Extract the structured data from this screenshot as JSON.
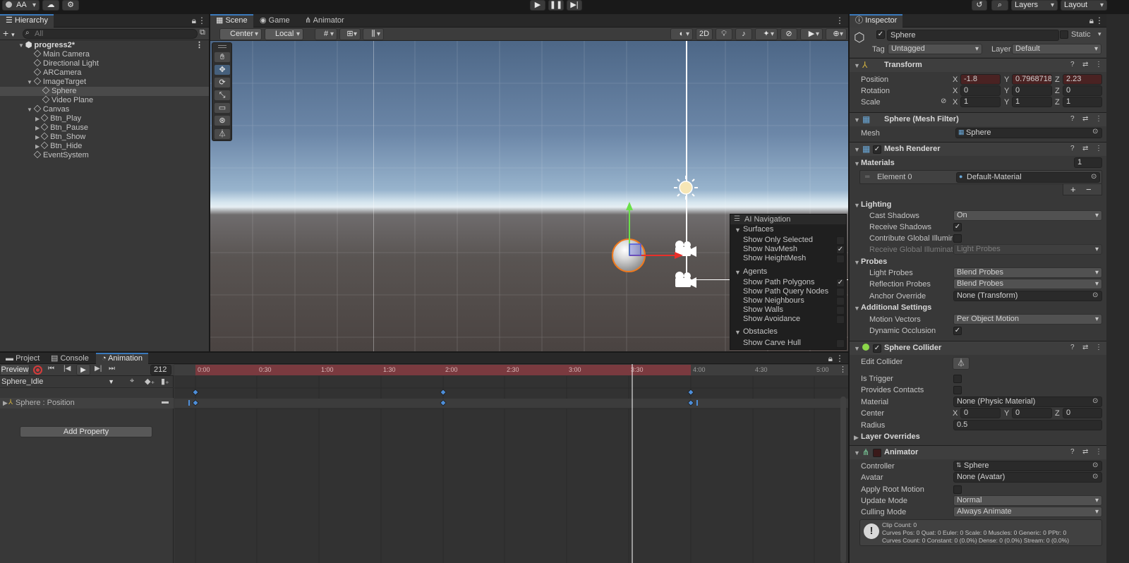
{
  "topbar": {
    "account_label": "AA",
    "layers_label": "Layers",
    "layout_label": "Layout"
  },
  "hierarchy": {
    "tab_label": "Hierarchy",
    "search_placeholder": "All",
    "items": [
      {
        "label": "progress2*"
      },
      {
        "label": "Main Camera"
      },
      {
        "label": "Directional Light"
      },
      {
        "label": "ARCamera"
      },
      {
        "label": "ImageTarget"
      },
      {
        "label": "Sphere"
      },
      {
        "label": "Video Plane"
      },
      {
        "label": "Canvas"
      },
      {
        "label": "Btn_Play"
      },
      {
        "label": "Btn_Pause"
      },
      {
        "label": "Btn_Show"
      },
      {
        "label": "Btn_Hide"
      },
      {
        "label": "EventSystem"
      }
    ]
  },
  "scene": {
    "tabs": [
      {
        "label": "Scene"
      },
      {
        "label": "Game"
      },
      {
        "label": "Animator"
      }
    ],
    "pivot_label": "Center",
    "space_label": "Local",
    "mode_2d_label": "2D",
    "ai_nav": {
      "title": "AI Navigation",
      "surfaces_label": "Surfaces",
      "surfaces": [
        {
          "label": "Show Only Selected",
          "checked": false
        },
        {
          "label": "Show NavMesh",
          "checked": true
        },
        {
          "label": "Show HeightMesh",
          "checked": false
        }
      ],
      "agents_label": "Agents",
      "agents": [
        {
          "label": "Show Path Polygons",
          "checked": true
        },
        {
          "label": "Show Path Query Nodes",
          "checked": false
        },
        {
          "label": "Show Neighbours",
          "checked": false
        },
        {
          "label": "Show Walls",
          "checked": false
        },
        {
          "label": "Show Avoidance",
          "checked": false
        }
      ],
      "obstacles_label": "Obstacles",
      "obstacles": [
        {
          "label": "Show Carve Hull",
          "checked": false
        }
      ]
    }
  },
  "bottom": {
    "tabs": [
      {
        "label": "Project"
      },
      {
        "label": "Console"
      },
      {
        "label": "Animation"
      }
    ],
    "preview_label": "Preview",
    "frame_value": "212",
    "clip_name": "Sphere_Idle",
    "property_label": "Sphere : Position",
    "add_property_label": "Add Property",
    "timeline_ticks": [
      "0:00",
      "0:30",
      "1:00",
      "1:30",
      "2:00",
      "2:30",
      "3:00",
      "3:30",
      "4:00",
      "4:30",
      "5:00"
    ]
  },
  "inspector": {
    "tab_label": "Inspector",
    "object_name": "Sphere",
    "static_label": "Static",
    "tag_label": "Tag",
    "tag_value": "Untagged",
    "layer_label": "Layer",
    "layer_value": "Default",
    "transform": {
      "title": "Transform",
      "position_label": "Position",
      "rotation_label": "Rotation",
      "scale_label": "Scale",
      "x": "X",
      "y": "Y",
      "z": "Z",
      "position": {
        "x": "-1.8",
        "y": "0.7968718",
        "z": "2.23"
      },
      "rotation": {
        "x": "0",
        "y": "0",
        "z": "0"
      },
      "scale": {
        "x": "1",
        "y": "1",
        "z": "1"
      }
    },
    "mesh_filter": {
      "title": "Sphere (Mesh Filter)",
      "mesh_label": "Mesh",
      "mesh_value": "Sphere"
    },
    "mesh_renderer": {
      "title": "Mesh Renderer",
      "materials_label": "Materials",
      "materials_count": "1",
      "element0_label": "Element 0",
      "element0_value": "Default-Material",
      "lighting_label": "Lighting",
      "cast_shadows_label": "Cast Shadows",
      "cast_shadows_value": "On",
      "receive_shadows_label": "Receive Shadows",
      "contribute_gi_label": "Contribute Global Illumina",
      "receive_gi_label": "Receive Global Illuminatio",
      "receive_gi_value": "Light Probes",
      "probes_label": "Probes",
      "light_probes_label": "Light Probes",
      "light_probes_value": "Blend Probes",
      "reflection_probes_label": "Reflection Probes",
      "reflection_probes_value": "Blend Probes",
      "anchor_override_label": "Anchor Override",
      "anchor_override_value": "None (Transform)",
      "additional_label": "Additional Settings",
      "motion_vectors_label": "Motion Vectors",
      "motion_vectors_value": "Per Object Motion",
      "dynamic_occlusion_label": "Dynamic Occlusion"
    },
    "sphere_collider": {
      "title": "Sphere Collider",
      "edit_collider_label": "Edit Collider",
      "is_trigger_label": "Is Trigger",
      "provides_contacts_label": "Provides Contacts",
      "material_label": "Material",
      "material_value": "None (Physic Material)",
      "center_label": "Center",
      "center": {
        "x": "0",
        "y": "0",
        "z": "0"
      },
      "radius_label": "Radius",
      "radius_value": "0.5",
      "layer_overrides_label": "Layer Overrides"
    },
    "animator": {
      "title": "Animator",
      "controller_label": "Controller",
      "controller_value": "Sphere",
      "avatar_label": "Avatar",
      "avatar_value": "None (Avatar)",
      "apply_root_motion_label": "Apply Root Motion",
      "update_mode_label": "Update Mode",
      "update_mode_value": "Normal",
      "culling_mode_label": "Culling Mode",
      "culling_mode_value": "Always Animate",
      "info_line1": "Clip Count: 0",
      "info_line2": "Curves Pos: 0 Quat: 0 Euler: 0 Scale: 0 Muscles: 0 Generic: 0 PPtr: 0",
      "info_line3": "Curves Count: 0 Constant: 0 (0.0%) Dense: 0 (0.0%) Stream: 0 (0.0%)"
    }
  },
  "colors": {
    "accent": "#3a79bb",
    "record_red": "#d33b3b",
    "timeline_red": "#7a3a3f",
    "position_field": "#4a2222"
  }
}
